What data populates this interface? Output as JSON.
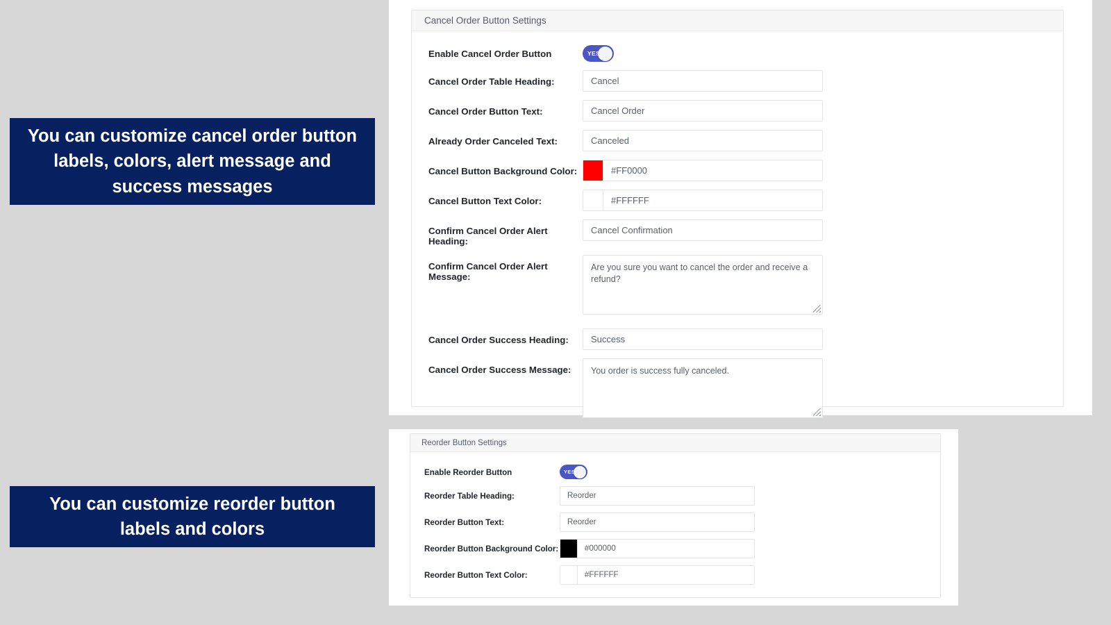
{
  "callouts": [
    {
      "text": "You can customize cancel order button labels, colors, alert message and success messages"
    },
    {
      "text": "You can customize reorder button labels and colors"
    }
  ],
  "colors": {
    "callout_background": "#07205F",
    "page_background": "#D7D7D7",
    "toggle_on": "#4A56C4",
    "card_header_background": "#F7F7F7",
    "input_border": "#E3E3E3",
    "label_text": "#22262B",
    "input_text": "#5B6169"
  },
  "cancel_panel": {
    "header": "Cancel Order Button Settings",
    "fields": [
      {
        "type": "toggle",
        "label": "Enable Cancel Order Button",
        "toggle_label": "YES",
        "state": "on"
      },
      {
        "type": "text",
        "label": "Cancel Order Table Heading:",
        "value": "Cancel"
      },
      {
        "type": "text",
        "label": "Cancel Order Button Text:",
        "value": "Cancel Order"
      },
      {
        "type": "text",
        "label": "Already Order Canceled Text:",
        "value": "Canceled"
      },
      {
        "type": "color",
        "label": "Cancel Button Background Color:",
        "value": "#FF0000",
        "swatch": "#FF0000"
      },
      {
        "type": "color",
        "label": "Cancel Button Text Color:",
        "value": "#FFFFFF",
        "swatch": "#FFFFFF"
      },
      {
        "type": "text",
        "label": "Confirm Cancel Order Alert Heading:",
        "value": "Cancel Confirmation"
      },
      {
        "type": "textarea",
        "label": "Confirm Cancel Order Alert Message:",
        "value": "Are you sure you want to cancel the order and receive a refund?"
      },
      {
        "type": "text",
        "label": "Cancel Order Success Heading:",
        "value": "Success"
      },
      {
        "type": "textarea",
        "label": "Cancel Order Success Message:",
        "value": "You order is success fully canceled."
      }
    ]
  },
  "reorder_panel": {
    "header": "Reorder Button Settings",
    "fields": [
      {
        "type": "toggle",
        "label": "Enable Reorder Button",
        "toggle_label": "YES",
        "state": "on"
      },
      {
        "type": "text",
        "label": "Reorder Table Heading:",
        "value": "Reorder"
      },
      {
        "type": "text",
        "label": "Reorder Button Text:",
        "value": "Reorder"
      },
      {
        "type": "color",
        "label": "Reorder Button Background Color:",
        "value": "#000000",
        "swatch": "#000000"
      },
      {
        "type": "color",
        "label": "Reorder Button Text Color:",
        "value": "#FFFFFF",
        "swatch": "#FFFFFF"
      }
    ]
  }
}
